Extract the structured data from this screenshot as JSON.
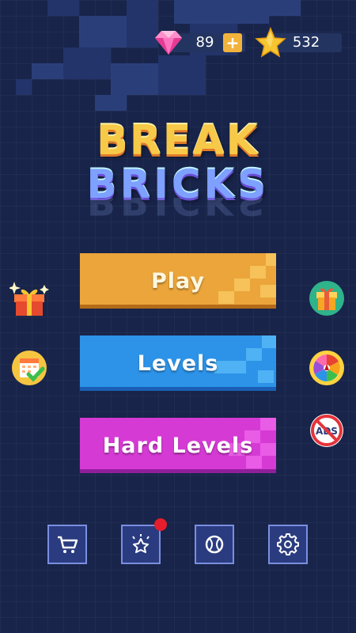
{
  "currency": {
    "gems": "89",
    "stars": "532",
    "gem_icon": "diamond-icon",
    "star_icon": "star-icon",
    "add_icon": "plus-icon"
  },
  "logo": {
    "line1": "BREAK",
    "line2": "BRICKS"
  },
  "menu": {
    "play": "Play",
    "levels": "Levels",
    "hard_levels": "Hard Levels"
  },
  "side_icons": {
    "left": [
      "gift-sparkle-icon",
      "daily-calendar-icon"
    ],
    "right": [
      "gift-box-icon",
      "lucky-wheel-icon",
      "no-ads-icon"
    ],
    "no_ads_text": "ADS"
  },
  "toolbar": [
    "shop-cart-icon",
    "achievement-icon",
    "ball-icon",
    "settings-gear-icon"
  ],
  "colors": {
    "background": "#18244a",
    "play": "#eba53a",
    "levels": "#2d93e8",
    "hard_levels": "#d63ad4",
    "accent_gold": "#f2b33d"
  }
}
